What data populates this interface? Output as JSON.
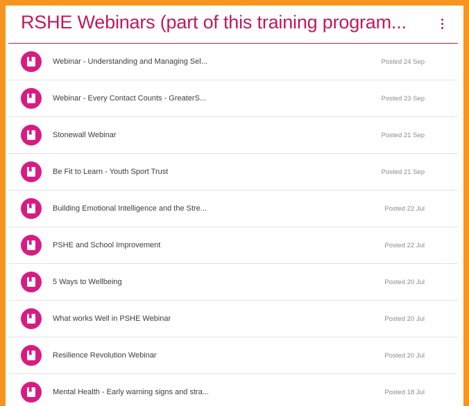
{
  "header": {
    "title": "RSHE Webinars (part of this training program...",
    "more_icon": "more-vert-icon"
  },
  "colors": {
    "accent": "#c2185b",
    "icon_bg": "#d81b83",
    "frame": "#f7941d"
  },
  "items": [
    {
      "title": "Webinar - Understanding and Managing Sel...",
      "date": "Posted 24 Sep",
      "icon": "material-icon"
    },
    {
      "title": "Webinar - Every Contact Counts - GreaterS...",
      "date": "Posted 23 Sep",
      "icon": "material-icon"
    },
    {
      "title": "Stonewall Webinar",
      "date": "Posted 21 Sep",
      "icon": "material-icon"
    },
    {
      "title": "Be Fit to Learn - Youth Sport Trust",
      "date": "Posted 21 Sep",
      "icon": "material-icon"
    },
    {
      "title": "Building Emotional Intelligence and the Stre...",
      "date": "Posted 22 Jul",
      "icon": "material-icon"
    },
    {
      "title": "PSHE and School Improvement",
      "date": "Posted 22 Jul",
      "icon": "material-icon"
    },
    {
      "title": "5 Ways to Wellbeing",
      "date": "Posted 20 Jul",
      "icon": "material-icon"
    },
    {
      "title": "What works Well in PSHE Webinar",
      "date": "Posted 20 Jul",
      "icon": "material-icon"
    },
    {
      "title": "Resilience Revolution Webinar",
      "date": "Posted 20 Jul",
      "icon": "material-icon"
    },
    {
      "title": "Mental Health - Early warning signs and stra...",
      "date": "Posted 18 Jul",
      "icon": "material-icon"
    }
  ]
}
